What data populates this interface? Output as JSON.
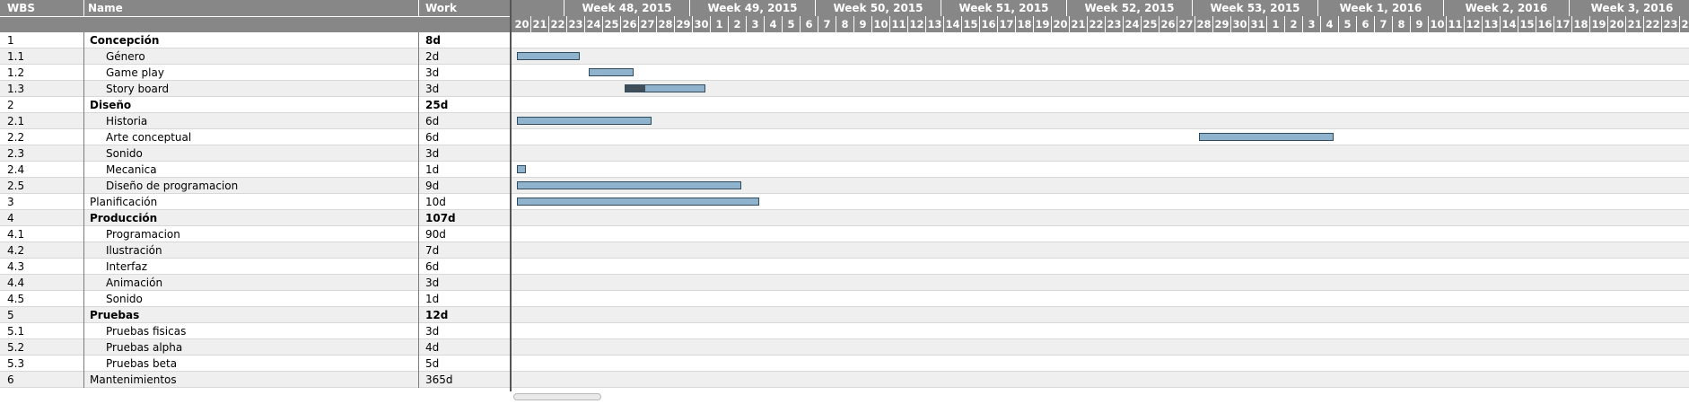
{
  "columns": {
    "wbs": "WBS",
    "name": "Name",
    "work": "Work"
  },
  "weeks": [
    "Week 48, 2015",
    "Week 49, 2015",
    "Week 50, 2015",
    "Week 51, 2015",
    "Week 52, 2015",
    "Week 53, 2015",
    "Week 1, 2016",
    "Week 2, 2016",
    "Week 3, 2016"
  ],
  "days": [
    "20",
    "21",
    "22",
    "23",
    "24",
    "25",
    "26",
    "27",
    "28",
    "29",
    "30",
    "1",
    "2",
    "3",
    "4",
    "5",
    "6",
    "7",
    "8",
    "9",
    "10",
    "11",
    "12",
    "13",
    "14",
    "15",
    "16",
    "17",
    "18",
    "19",
    "20",
    "21",
    "22",
    "23",
    "24",
    "25",
    "26",
    "27",
    "28",
    "29",
    "30",
    "31",
    "1",
    "2",
    "3",
    "4",
    "5",
    "6",
    "7",
    "8",
    "9",
    "10",
    "11",
    "12",
    "13",
    "14",
    "15",
    "16",
    "17",
    "18",
    "19",
    "20",
    "21",
    "22",
    "23",
    "24",
    "25"
  ],
  "tasks": [
    {
      "wbs": "1",
      "name": "Concepción",
      "work": "8d",
      "summary": true
    },
    {
      "wbs": "1.1",
      "name": "Género",
      "work": "2d",
      "level": 1,
      "bar": {
        "start_day_index": 0,
        "days": 3.5
      }
    },
    {
      "wbs": "1.2",
      "name": "Game play",
      "work": "3d",
      "level": 1,
      "bar": {
        "start_day_index": 4,
        "days": 2.5
      }
    },
    {
      "wbs": "1.3",
      "name": "Story board",
      "work": "3d",
      "level": 1,
      "bar": {
        "start_day_index": 6,
        "days": 4.5,
        "progress": 0.25
      }
    },
    {
      "wbs": "2",
      "name": "Diseño",
      "work": "25d",
      "summary": true
    },
    {
      "wbs": "2.1",
      "name": "Historia",
      "work": "6d",
      "level": 1,
      "bar": {
        "start_day_index": 0,
        "days": 7.5
      }
    },
    {
      "wbs": "2.2",
      "name": "Arte conceptual",
      "work": "6d",
      "level": 1,
      "bar": {
        "start_day_index": 38,
        "days": 7.5
      }
    },
    {
      "wbs": "2.3",
      "name": "Sonido",
      "work": "3d",
      "level": 1
    },
    {
      "wbs": "2.4",
      "name": "Mecanica",
      "work": "1d",
      "level": 1,
      "bar": {
        "start_day_index": 0,
        "days": 0.5
      }
    },
    {
      "wbs": "2.5",
      "name": "Diseño de programacion",
      "work": "9d",
      "level": 1,
      "bar": {
        "start_day_index": 0,
        "days": 12.5
      }
    },
    {
      "wbs": "3",
      "name": "Planificación",
      "work": "10d",
      "bar": {
        "start_day_index": 0,
        "days": 13.5
      }
    },
    {
      "wbs": "4",
      "name": "Producción",
      "work": "107d",
      "summary": true
    },
    {
      "wbs": "4.1",
      "name": "Programacion",
      "work": "90d",
      "level": 1
    },
    {
      "wbs": "4.2",
      "name": "Ilustración",
      "work": "7d",
      "level": 1
    },
    {
      "wbs": "4.3",
      "name": "Interfaz",
      "work": "6d",
      "level": 1
    },
    {
      "wbs": "4.4",
      "name": "Animación",
      "work": "3d",
      "level": 1
    },
    {
      "wbs": "4.5",
      "name": "Sonido",
      "work": "1d",
      "level": 1
    },
    {
      "wbs": "5",
      "name": "Pruebas",
      "work": "12d",
      "summary": true
    },
    {
      "wbs": "5.1",
      "name": "Pruebas fisicas",
      "work": "3d",
      "level": 1
    },
    {
      "wbs": "5.2",
      "name": "Pruebas alpha",
      "work": "4d",
      "level": 1
    },
    {
      "wbs": "5.3",
      "name": "Pruebas beta",
      "work": "5d",
      "level": 1
    },
    {
      "wbs": "6",
      "name": "Mantenimientos",
      "work": "365d"
    }
  ]
}
